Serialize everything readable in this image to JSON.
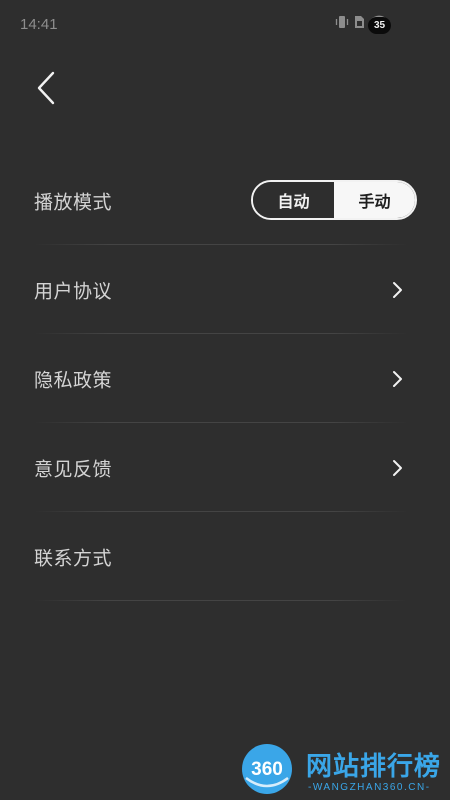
{
  "status_bar": {
    "time": "14:41",
    "battery": "35",
    "icons": [
      "vibrate-icon",
      "sim-icon",
      "wifi-icon"
    ]
  },
  "nav": {
    "back_icon": "chevron-left-icon"
  },
  "settings": {
    "playback_mode": {
      "label": "播放模式",
      "options": [
        "自动",
        "手动"
      ],
      "selected": "手动"
    },
    "items": [
      {
        "label": "用户协议",
        "chevron": true
      },
      {
        "label": "隐私政策",
        "chevron": true
      },
      {
        "label": "意见反馈",
        "chevron": true
      },
      {
        "label": "联系方式",
        "chevron": false
      }
    ]
  },
  "watermark": {
    "logo_text": "360",
    "title": "网站排行榜",
    "subtitle": "-WANGZHAN360.CN-"
  },
  "colors": {
    "background": "#2e2e2e",
    "text": "#d4d4d4",
    "accent": "#3aa6e8"
  }
}
